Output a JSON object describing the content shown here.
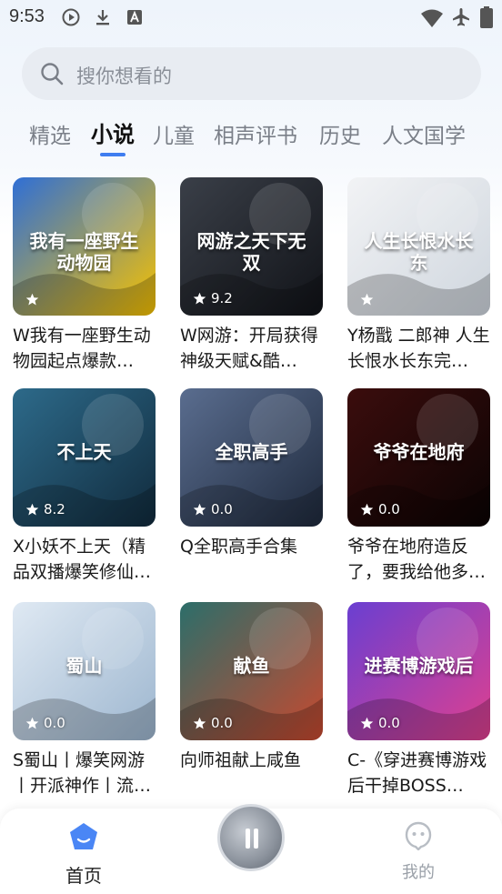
{
  "status_bar": {
    "time": "9:53"
  },
  "search": {
    "placeholder": "搜你想看的"
  },
  "tabs": [
    {
      "label": "精选"
    },
    {
      "label": "小说"
    },
    {
      "label": "儿童"
    },
    {
      "label": "相声评书"
    },
    {
      "label": "历史"
    },
    {
      "label": "人文国学"
    }
  ],
  "active_tab": "小说",
  "books": [
    {
      "title": "W我有一座野生动物园起点爆款…",
      "rating": "",
      "cover_text": "我有一座野生动物园",
      "colors": [
        "#2f6fd6",
        "#f7c200"
      ]
    },
    {
      "title": "W网游：开局获得神级天赋&酷…",
      "rating": "9.2",
      "cover_text": "网游之天下无双",
      "colors": [
        "#3a3f48",
        "#111318"
      ]
    },
    {
      "title": "Y杨戬 二郎神 人生长恨水长东完…",
      "rating": "",
      "cover_text": "人生长恨水长东",
      "colors": [
        "#f2f3f5",
        "#cfd6de"
      ]
    },
    {
      "title": "X小妖不上天（精品双播爆笑修仙…",
      "rating": "8.2",
      "cover_text": "不上天",
      "colors": [
        "#2d6a8a",
        "#112b3d"
      ]
    },
    {
      "title": "Q全职高手合集",
      "rating": "0.0",
      "cover_text": "全职高手",
      "colors": [
        "#5a6d8f",
        "#1f2a3d"
      ]
    },
    {
      "title": "爷爷在地府造反了，要我给他多…",
      "rating": "0.0",
      "cover_text": "爷爷在地府",
      "colors": [
        "#3b0d0d",
        "#0b0303"
      ]
    },
    {
      "title": "S蜀山丨爆笑网游丨开派神作丨流…",
      "rating": "0.0",
      "cover_text": "蜀山",
      "colors": [
        "#dfe9f3",
        "#9db6cf"
      ]
    },
    {
      "title": "向师祖献上咸鱼",
      "rating": "0.0",
      "cover_text": "献鱼",
      "colors": [
        "#2c6e6a",
        "#c8492f"
      ]
    },
    {
      "title": "C-《穿进赛博游戏后干掉BOSS…",
      "rating": "0.0",
      "cover_text": "进赛博游戏后",
      "colors": [
        "#6a3fd1",
        "#e0408f"
      ]
    }
  ],
  "bottom_nav": {
    "home_label": "首页",
    "mine_label": "我的"
  },
  "colors": {
    "accent": "#3f7df0",
    "home_icon": "#4a86f5"
  }
}
